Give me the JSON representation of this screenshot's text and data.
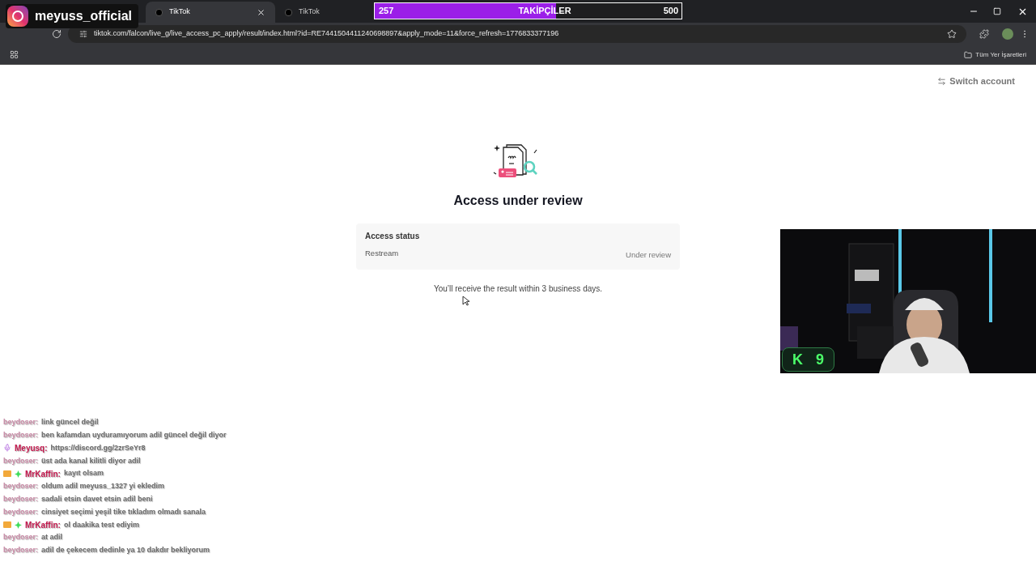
{
  "overlay_badge": {
    "handle": "meyuss_official"
  },
  "tabs": [
    {
      "title": "TikTok",
      "selected": true
    },
    {
      "title": "TikTok",
      "selected": false
    }
  ],
  "follower_goal": {
    "current": "257",
    "label": "TAKİPÇİLER",
    "target": "500",
    "level": 0.59
  },
  "address_bar": {
    "url": "tiktok.com/falcon/live_g/live_access_pc_apply/result/index.html?id=RE7441504411240698897&apply_mode=11&force_refresh=1776833377196"
  },
  "bookmarks_bar": {
    "folder": "Tüm Yer İşaretleri"
  },
  "page": {
    "switch_account": "Switch account",
    "title": "Access under review",
    "status_card": {
      "heading": "Access status",
      "item": "Restream",
      "status": "Under review"
    },
    "note": "You’ll receive the result within 3 business days."
  },
  "webcam": {
    "kind": "picture",
    "badge_logo": "K",
    "badge_count": "9"
  },
  "chat": [
    {
      "kind": "message",
      "user": "beydoser:",
      "text": "link güncel değil"
    },
    {
      "kind": "message",
      "user": "beydoser:",
      "text": "ben kafamdan uyduramıyorum adil güncel değil diyor"
    },
    {
      "kind": "mod",
      "user": "Meyusq:",
      "text": "https://discord.gg/2zrSeYr8"
    },
    {
      "kind": "message",
      "user": "beydoser:",
      "text": "üst ada kanal kilitli diyor adil"
    },
    {
      "kind": "sub",
      "user": "MrKaffin:",
      "text": "kayıt olsam"
    },
    {
      "kind": "message",
      "user": "beydoser:",
      "text": "oldum adil meyuss_1327 yi ekledim"
    },
    {
      "kind": "message",
      "user": "beydoser:",
      "text": "sadali etsin davet etsin adil beni"
    },
    {
      "kind": "message",
      "user": "beydoser:",
      "text": "cinsiyet seçimi yeşil tike tıkladım olmadı sanala"
    },
    {
      "kind": "sub",
      "user": "MrKaffin:",
      "text": "ol daakika test ediyim"
    },
    {
      "kind": "message",
      "user": "beydoser:",
      "text": "at adil"
    },
    {
      "kind": "message",
      "user": "beydoser:",
      "text": "adil de çekecem dedinle ya 10 dakdır bekliyorum"
    }
  ]
}
